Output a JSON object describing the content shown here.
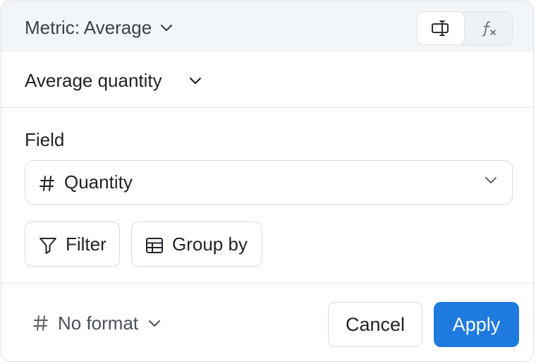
{
  "header": {
    "metric_label": "Metric: Average",
    "mode_toggle": {
      "visual_icon": "field-editor-icon",
      "formula_icon": "function-icon"
    }
  },
  "aggregation": {
    "label": "Average quantity"
  },
  "field": {
    "label": "Field",
    "value": "Quantity",
    "type_icon": "number-hash-icon"
  },
  "actions": {
    "filter_label": "Filter",
    "groupby_label": "Group by"
  },
  "footer": {
    "format_label": "No format",
    "cancel_label": "Cancel",
    "apply_label": "Apply"
  },
  "colors": {
    "primary": "#1f7ae0",
    "header_bg": "#f3f6f9",
    "border": "#d6dbe1"
  }
}
